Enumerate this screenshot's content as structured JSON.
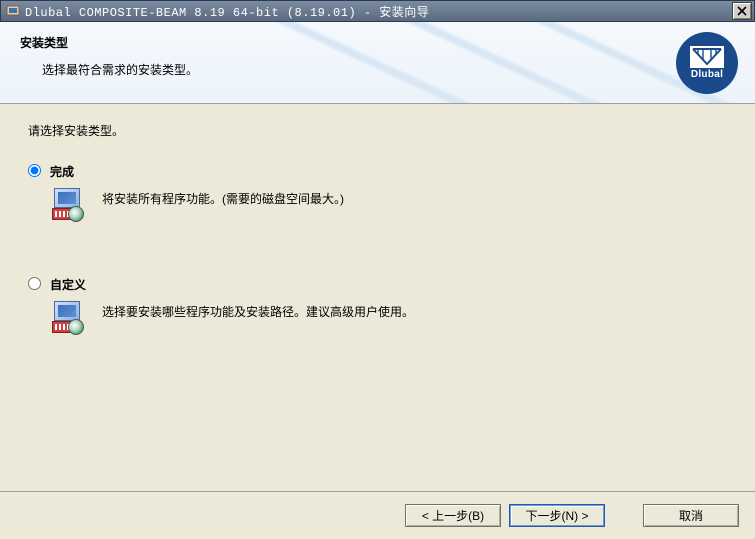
{
  "window": {
    "title": "Dlubal COMPOSITE-BEAM 8.19 64-bit (8.19.01) - 安装向导"
  },
  "header": {
    "title": "安装类型",
    "subtitle": "选择最符合需求的安装类型。",
    "logo_text": "Dlubal"
  },
  "content": {
    "instruction": "请选择安装类型。",
    "options": {
      "complete": {
        "label": "完成",
        "description": "将安装所有程序功能。(需要的磁盘空间最大。)"
      },
      "custom": {
        "label": "自定义",
        "description": "选择要安装哪些程序功能及安装路径。建议高级用户使用。"
      }
    }
  },
  "footer": {
    "back": "< 上一步(B)",
    "next": "下一步(N) >",
    "cancel": "取消"
  }
}
